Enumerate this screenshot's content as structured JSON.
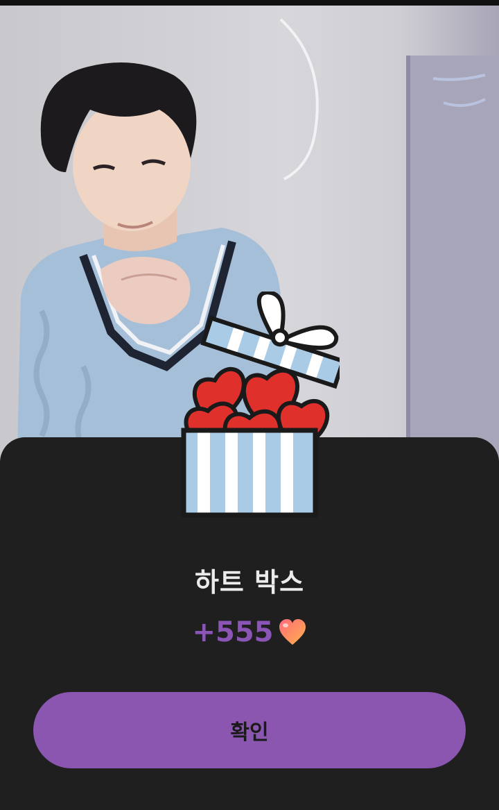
{
  "modal": {
    "title": "하트 박스",
    "reward_amount": "+555",
    "confirm_label": "확인",
    "accent_color": "#8a56b0"
  },
  "icons": {
    "gift": "open-gift-box-with-hearts-icon",
    "reward": "heart-icon"
  }
}
